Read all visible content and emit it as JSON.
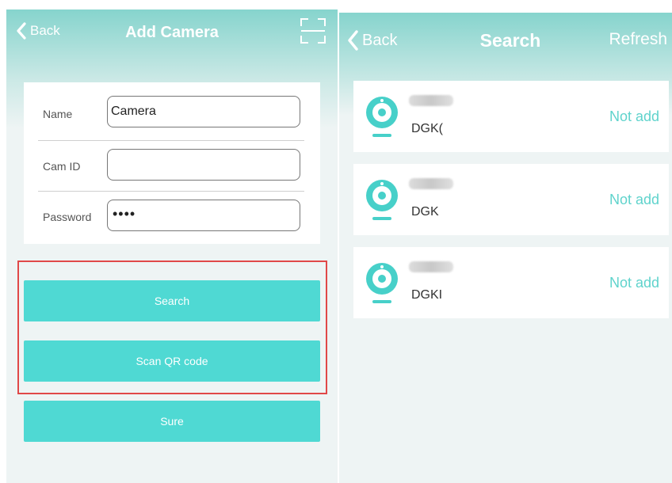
{
  "add_camera": {
    "back_label": "Back",
    "title": "Add Camera",
    "form": {
      "name_label": "Name",
      "name_value": "Camera",
      "cam_id_label": "Cam ID",
      "cam_id_value": "",
      "password_label": "Password",
      "password_mask": "••••"
    },
    "buttons": {
      "search": "Search",
      "scan_qr": "Scan QR code",
      "sure": "Sure"
    },
    "icons": {
      "back": "chevron-left-icon",
      "scan": "qr-scan-icon"
    }
  },
  "search_screen": {
    "back_label": "Back",
    "title": "Search",
    "refresh_label": "Refresh",
    "devices": [
      {
        "id": "DGK(",
        "status": "Not add"
      },
      {
        "id": "DGK",
        "status": "Not add"
      },
      {
        "id": "DGKI",
        "status": "Not add"
      }
    ],
    "icons": {
      "device": "camera-icon"
    }
  },
  "colors": {
    "accent": "#4fd9d3",
    "header_top": "#86d4cd",
    "status_text": "#5fd3cc",
    "highlight_border": "#e04848"
  }
}
